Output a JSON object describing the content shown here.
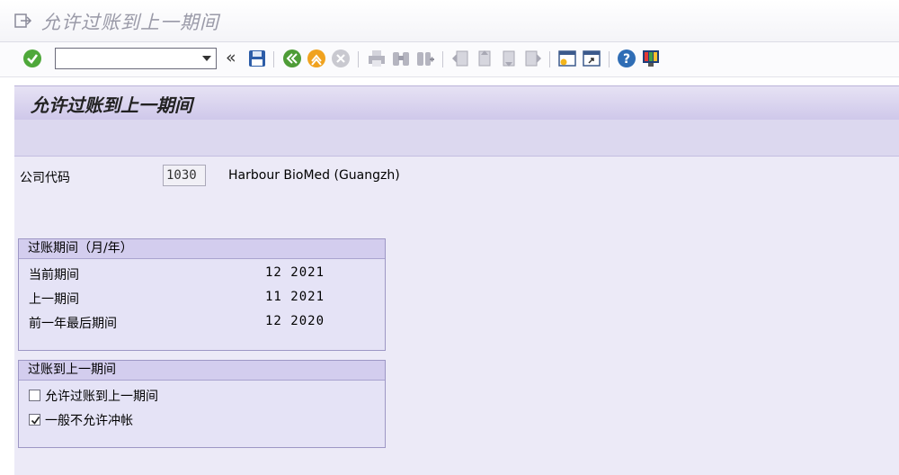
{
  "window": {
    "title": "允许过账到上一期间"
  },
  "toolbar": {
    "command_field_value": "",
    "back_chevron": "«",
    "icons": [
      "enter-icon",
      "command-dropdown-icon",
      "save-icon",
      "back-icon",
      "exit-icon",
      "cancel-icon",
      "print-icon",
      "find-icon",
      "find-next-icon",
      "first-page-icon",
      "previous-page-icon",
      "next-page-icon",
      "last-page-icon",
      "create-session-icon",
      "generate-shortcut-icon",
      "help-icon",
      "customize-layout-icon"
    ]
  },
  "screen": {
    "title": "允许过账到上一期间"
  },
  "company": {
    "label": "公司代码",
    "code": "1030",
    "name": "Harbour BioMed (Guangzh)"
  },
  "period_group": {
    "title": "过账期间（月/年）",
    "rows": [
      {
        "label": "当前期间",
        "value": "12 2021"
      },
      {
        "label": "上一期间",
        "value": "11 2021"
      },
      {
        "label": "前一年最后期间",
        "value": "12 2020"
      }
    ]
  },
  "posting_group": {
    "title": "过账到上一期间",
    "options": [
      {
        "label": "允许过账到上一期间",
        "checked": false
      },
      {
        "label": "一般不允许冲帐",
        "checked": true
      }
    ]
  },
  "colors": {
    "header_purple": "#cfc8ea",
    "group_border": "#9d97c5",
    "content_bg": "#eceaf7"
  }
}
